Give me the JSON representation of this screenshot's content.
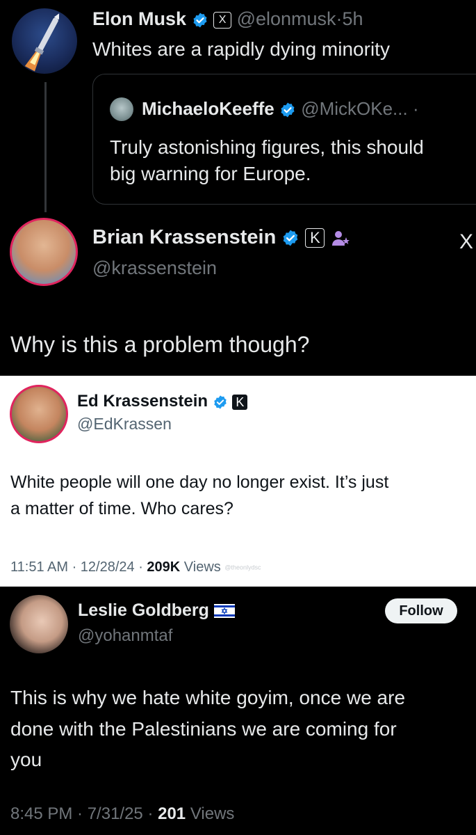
{
  "post1": {
    "name": "Elon Musk",
    "badge_letter": "X",
    "handle": "@elonmusk",
    "sep": "·",
    "time": "5h",
    "text": "Whites are a rapidly dying minority",
    "quote": {
      "name": "MichaeloKeeffe",
      "handle": "@MickOKe...",
      "sep": "·",
      "line1": "Truly astonishing figures, this should",
      "line2": "big warning for Europe."
    }
  },
  "post2": {
    "name": "Brian Krassenstein",
    "badge_letter": "K",
    "handle": "@krassenstein",
    "x_logo": "X",
    "text": "Why is this a problem though?"
  },
  "post3": {
    "name": "Ed Krassenstein",
    "badge_letter": "K",
    "handle": "@EdKrassen",
    "line1": "White people will one day no longer exist. It’s just",
    "line2": "a matter of time. Who cares?",
    "time": "11:51 AM · 12/28/24 · ",
    "views_count": "209K",
    "views_label": "Views",
    "watermark": "@theonlydsc"
  },
  "post4": {
    "name": "Leslie Goldberg",
    "handle": "@yohanmtaf",
    "follow_label": "Follow",
    "line1": "This is why we hate white goyim, once we are",
    "line2": "done with the Palestinians we are coming for",
    "line3": "you",
    "time": "8:45 PM · 7/31/25 · ",
    "views_count": "201",
    "views_label": "Views"
  },
  "colors": {
    "verified": "#1d9bf0",
    "dark_bg": "#000000",
    "light_bg": "#ffffff"
  },
  "icons": [
    "rocket-avatar-icon",
    "verified-icon",
    "x-badge-icon",
    "x-logo-icon",
    "k-badge-icon",
    "flag-israel-icon",
    "person-star-icon"
  ]
}
